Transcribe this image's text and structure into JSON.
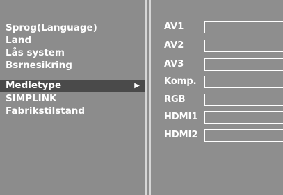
{
  "menu": {
    "items": [
      {
        "label": "Sprog(Language)"
      },
      {
        "label": "Land"
      },
      {
        "label": "Lås system"
      },
      {
        "label": "Bsrnesikring"
      },
      {
        "label": "Medietype",
        "selected": true,
        "arrow": "▶"
      },
      {
        "label": "SIMPLINK"
      },
      {
        "label": "Fabrikstilstand"
      }
    ]
  },
  "inputs": {
    "items": [
      {
        "label": "AV1"
      },
      {
        "label": "AV2"
      },
      {
        "label": "AV3"
      },
      {
        "label": "Komp."
      },
      {
        "label": "RGB"
      },
      {
        "label": "HDMI1"
      },
      {
        "label": "HDMI2"
      }
    ]
  },
  "colors": {
    "background": "#8e8e8e",
    "selected": "#4a4a4a",
    "divider": "#d6d6d6",
    "text": "#ffffff"
  }
}
